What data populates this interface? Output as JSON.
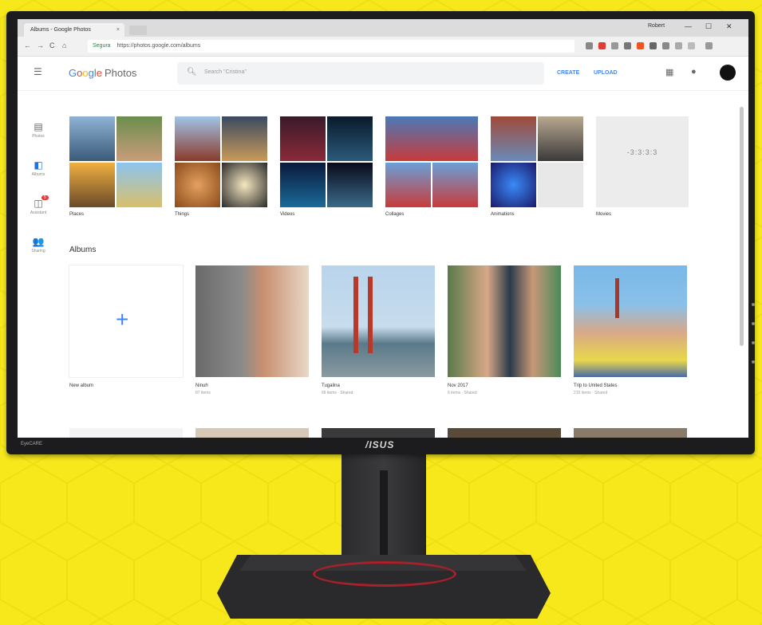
{
  "browser": {
    "tab_title": "Albums - Google Photos",
    "tab_close": "×",
    "profile_name": "Robert",
    "window_controls": [
      "—",
      "☐",
      "✕"
    ],
    "nav_buttons": [
      "←",
      "→",
      "C",
      "⌂"
    ],
    "url_secure_label": "Segura",
    "url": "https://photos.google.com/albums"
  },
  "app": {
    "logo_letters": [
      "G",
      "o",
      "o",
      "g",
      "l",
      "e"
    ],
    "logo_suffix": "Photos",
    "search_placeholder": "Search \"Cristina\"",
    "create_label": "CREATE",
    "upload_label": "UPLOAD"
  },
  "rail": [
    {
      "icon": "photos-icon",
      "label": "Photos",
      "glyph": "▤"
    },
    {
      "icon": "albums-icon",
      "label": "Albums",
      "glyph": "◧"
    },
    {
      "icon": "assistant-icon",
      "label": "Assistant",
      "glyph": "◫",
      "badge": "5"
    },
    {
      "icon": "sharing-icon",
      "label": "Sharing",
      "glyph": "👥"
    }
  ],
  "categories": [
    {
      "name": "Places"
    },
    {
      "name": "Things"
    },
    {
      "name": "Videos"
    },
    {
      "name": "Collages"
    },
    {
      "name": "Animations"
    },
    {
      "name": "Movies",
      "placeholder": "-3:3:3:3"
    }
  ],
  "section_title": "Albums",
  "albums": [
    {
      "name": "New album",
      "meta": ""
    },
    {
      "name": "Ninuh",
      "meta": "87 items"
    },
    {
      "name": "Tugalina",
      "meta": "66 items · Shared"
    },
    {
      "name": "Nov 2017",
      "meta": "6 items · Shared"
    },
    {
      "name": "Trip to United States",
      "meta": "215 items · Shared"
    }
  ],
  "monitor": {
    "brand": "/ISUS",
    "bezel_label": "EyeCARE"
  },
  "colors": {
    "background": "#f7e81c",
    "accent": "#4285f4",
    "badge": "#e53935"
  }
}
